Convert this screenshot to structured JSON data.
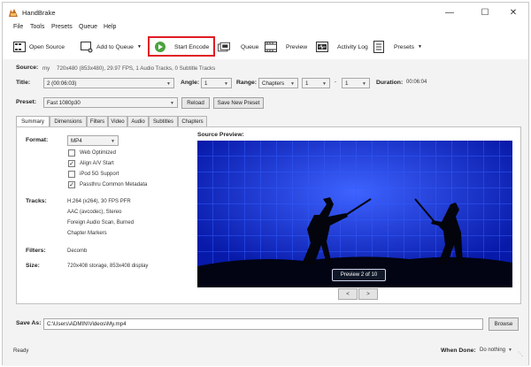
{
  "window": {
    "title": "HandBrake"
  },
  "menu": [
    "File",
    "Tools",
    "Presets",
    "Queue",
    "Help"
  ],
  "toolbar": {
    "open_source": "Open Source",
    "add_to_queue": "Add to Queue",
    "start_encode": "Start Encode",
    "queue": "Queue",
    "preview": "Preview",
    "activity_log": "Activity Log",
    "presets": "Presets"
  },
  "source": {
    "label": "Source:",
    "name": "my",
    "info": "720x480 (853x480), 29.97 FPS, 1 Audio Tracks, 0 Subtitle Tracks"
  },
  "title_row": {
    "title_label": "Title:",
    "title_value": "2 (00:06:03)",
    "angle_label": "Angle:",
    "angle_value": "1",
    "range_label": "Range:",
    "range_type": "Chapters",
    "range_start": "1",
    "range_sep": "-",
    "range_end": "1",
    "duration_label": "Duration:",
    "duration_value": "00:06:04"
  },
  "preset_row": {
    "label": "Preset:",
    "value": "Fast 1080p30",
    "reload": "Reload",
    "save_new": "Save New Preset"
  },
  "tabs": [
    "Summary",
    "Dimensions",
    "Filters",
    "Video",
    "Audio",
    "Subtitles",
    "Chapters"
  ],
  "summary": {
    "format_label": "Format:",
    "format_value": "MP4",
    "options": [
      {
        "label": "Web Optimized",
        "checked": false
      },
      {
        "label": "Align A/V Start",
        "checked": true
      },
      {
        "label": "iPod 5G Support",
        "checked": false
      },
      {
        "label": "Passthru Common Metadata",
        "checked": true
      }
    ],
    "tracks_label": "Tracks:",
    "tracks": [
      "H.264 (x264), 30 FPS PFR",
      "AAC (avcodec), Stereo",
      "Foreign Audio Scan, Burned",
      "Chapter Markers"
    ],
    "filters_label": "Filters:",
    "filters_value": "Decomb",
    "size_label": "Size:",
    "size_value": "720x408 storage, 853x408 display"
  },
  "preview": {
    "heading": "Source Preview:",
    "badge": "Preview 2 of 10",
    "prev": "<",
    "next": ">"
  },
  "save_as": {
    "label": "Save As:",
    "path": "C:\\Users\\ADMIN\\Videos\\My.mp4",
    "browse": "Browse"
  },
  "status": {
    "text": "Ready",
    "when_done_label": "When Done:",
    "when_done_value": "Do nothing"
  },
  "colors": {
    "highlight": "#e01b24",
    "preview_bg": "#0b2ec4",
    "play_green": "#4aa33d"
  }
}
